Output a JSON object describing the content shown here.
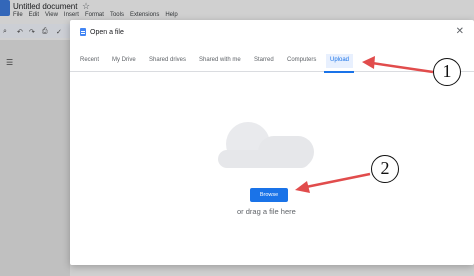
{
  "document": {
    "title": "Untitled document",
    "menu": [
      "File",
      "Edit",
      "View",
      "Insert",
      "Format",
      "Tools",
      "Extensions",
      "Help"
    ]
  },
  "dialog": {
    "title": "Open a file",
    "tabs": [
      "Recent",
      "My Drive",
      "Shared drives",
      "Shared with me",
      "Starred",
      "Computers",
      "Upload"
    ],
    "active_tab": "Upload",
    "browse_label": "Browse",
    "drag_text": "or drag a file here"
  },
  "annotations": {
    "marker_1": "1",
    "marker_2": "2"
  },
  "colors": {
    "accent": "#1a73e8",
    "arrow": "#e14c4c"
  }
}
